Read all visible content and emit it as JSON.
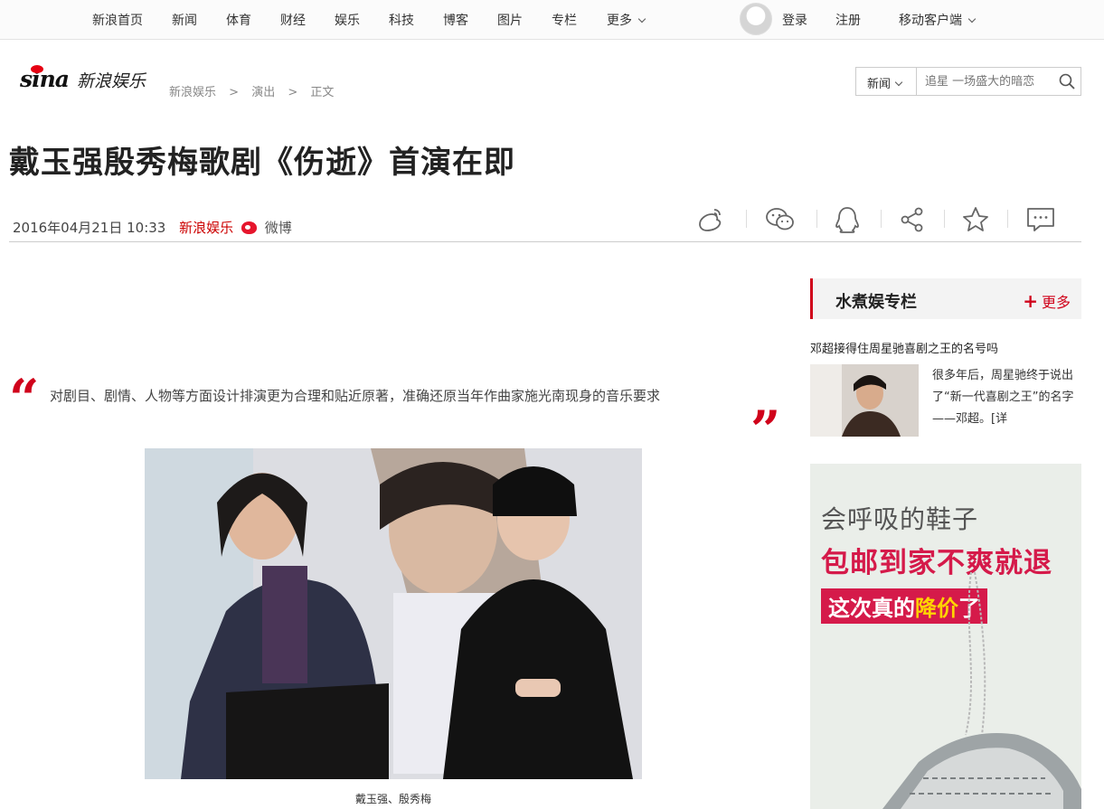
{
  "topnav": {
    "items": [
      "新浪首页",
      "新闻",
      "体育",
      "财经",
      "娱乐",
      "科技",
      "博客",
      "图片",
      "专栏",
      "更多"
    ],
    "login": "登录",
    "register": "注册",
    "mobile": "移动客户端"
  },
  "header": {
    "logo_brand": "sina",
    "logo_channel": "新浪娱乐",
    "breadcrumb": [
      "新浪娱乐",
      ">",
      "演出",
      ">",
      "正文"
    ],
    "search_category": "新闻",
    "search_placeholder": "追星 一场盛大的暗恋"
  },
  "article": {
    "title": "戴玉强殷秀梅歌剧《伤逝》首演在即",
    "date": "2016年04月21日 10:33",
    "source": "新浪娱乐",
    "weibo_label": "微博",
    "quote": "对剧目、剧情、人物等方面设计排演更为合理和贴近原著，准确还原当年作曲家施光南现身的音乐要求",
    "photo_caption": "戴玉强、殷秀梅"
  },
  "share": {
    "icons": [
      "weibo-share-icon",
      "wechat-icon",
      "qq-icon",
      "share-icon",
      "favorite-star-icon",
      "comment-icon"
    ]
  },
  "sidebar": {
    "section_title": "水煮娱专栏",
    "more": "更多",
    "article_title": "邓超接得住周星驰喜剧之王的名号吗",
    "article_desc": "很多年后，周星驰终于说出了“新一代喜剧之王”的名字——邓超。[详"
  },
  "ad": {
    "line1": "会呼吸的鞋子",
    "line2": "包邮到家不爽就退",
    "line3_a": "这次真的",
    "line3_b": "降价",
    "line3_c": "了"
  },
  "colors": {
    "accent": "#d0021b",
    "ad_red": "#d51a4a"
  }
}
